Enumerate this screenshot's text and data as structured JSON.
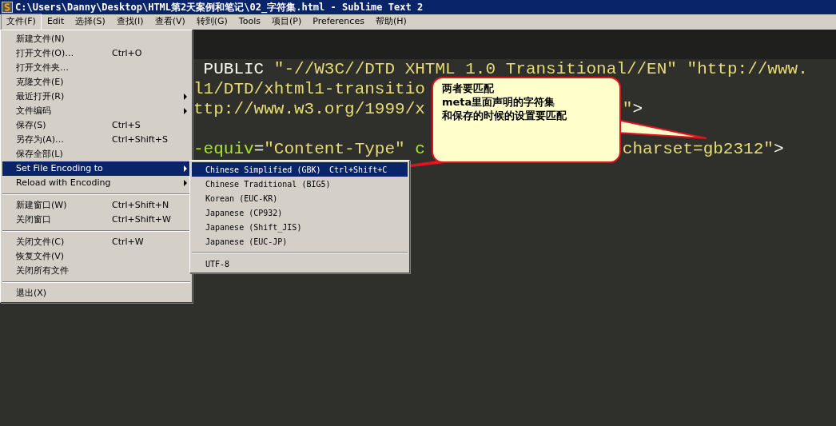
{
  "window": {
    "title": "C:\\Users\\Danny\\Desktop\\HTML第2天案例和笔记\\02_字符集.html - Sublime Text 2"
  },
  "menubar": [
    {
      "label": "文件(F)",
      "selected": true
    },
    {
      "label": "Edit",
      "selected": false
    },
    {
      "label": "选择(S)",
      "selected": false
    },
    {
      "label": "查找(I)",
      "selected": false
    },
    {
      "label": "查看(V)",
      "selected": false
    },
    {
      "label": "转到(G)",
      "selected": false
    },
    {
      "label": "Tools",
      "selected": false
    },
    {
      "label": "项目(P)",
      "selected": false
    },
    {
      "label": "Preferences",
      "selected": false
    },
    {
      "label": "帮助(H)",
      "selected": false
    }
  ],
  "code_lines": [
    {
      "kind": "code",
      "left": [
        {
          "kind": "plain",
          "text": " PUBLIC "
        },
        {
          "kind": "string",
          "text": "\"-//W3C//DTD XHTML 1.0 Transitional//EN\""
        },
        {
          "kind": "string",
          "text": " \"http://www."
        }
      ]
    },
    {
      "kind": "code",
      "left": [
        {
          "kind": "string",
          "text": "l1/DTD/xhtml1-transitio"
        }
      ]
    },
    {
      "kind": "code",
      "left": [
        {
          "kind": "string",
          "text": "ttp://www.w3.org/1999/x"
        }
      ],
      "right": [
        {
          "kind": "string",
          "text": "\""
        },
        {
          "kind": "plain",
          "text": ">"
        }
      ]
    },
    {
      "kind": "blank"
    },
    {
      "kind": "code",
      "left": [
        {
          "kind": "attr",
          "text": "-equiv"
        },
        {
          "kind": "plain",
          "text": "="
        },
        {
          "kind": "string",
          "text": "\"Content-Type\" "
        },
        {
          "kind": "attr",
          "text": "c"
        }
      ],
      "right": [
        {
          "kind": "string",
          "text": "charset=gb2312\""
        },
        {
          "kind": "plain",
          "text": ">"
        }
      ]
    }
  ],
  "file_menu": [
    {
      "kind": "item",
      "label": "新建文件(N)",
      "selected": false
    },
    {
      "kind": "item",
      "label": "打开文件(O)…",
      "shortcut": "Ctrl+O",
      "selected": false
    },
    {
      "kind": "item",
      "label": "打开文件夹…",
      "selected": false
    },
    {
      "kind": "item",
      "label": "克隆文件(E)",
      "selected": false
    },
    {
      "kind": "item",
      "label": "最近打开(R)",
      "submenu": true,
      "selected": false
    },
    {
      "kind": "item",
      "label": "文件编码",
      "submenu": true,
      "selected": false
    },
    {
      "kind": "item",
      "label": "保存(S)",
      "shortcut": "Ctrl+S",
      "selected": false
    },
    {
      "kind": "item",
      "label": "另存为(A)…",
      "shortcut": "Ctrl+Shift+S",
      "selected": false
    },
    {
      "kind": "item",
      "label": "保存全部(L)",
      "selected": false
    },
    {
      "kind": "item",
      "label": "Set File Encoding to",
      "submenu": true,
      "selected": true
    },
    {
      "kind": "item",
      "label": "Reload with Encoding",
      "submenu": true,
      "selected": false
    },
    {
      "kind": "separator"
    },
    {
      "kind": "item",
      "label": "新建窗口(W)",
      "shortcut": "Ctrl+Shift+N",
      "selected": false
    },
    {
      "kind": "item",
      "label": "关闭窗口",
      "shortcut": "Ctrl+Shift+W",
      "selected": false
    },
    {
      "kind": "separator"
    },
    {
      "kind": "item",
      "label": "关闭文件(C)",
      "shortcut": "Ctrl+W",
      "selected": false
    },
    {
      "kind": "item",
      "label": "恢复文件(V)",
      "selected": false
    },
    {
      "kind": "item",
      "label": "关闭所有文件",
      "selected": false
    },
    {
      "kind": "separator"
    },
    {
      "kind": "item",
      "label": "退出(X)",
      "selected": false
    }
  ],
  "encoding_menu": [
    {
      "kind": "item",
      "label": "Chinese Simplified (GBK)",
      "shortcut": "Ctrl+Shift+C",
      "selected": true
    },
    {
      "kind": "item",
      "label": "Chinese Traditional (BIG5)",
      "selected": false
    },
    {
      "kind": "item",
      "label": "Korean (EUC-KR)",
      "selected": false
    },
    {
      "kind": "item",
      "label": "Japanese (CP932)",
      "selected": false
    },
    {
      "kind": "item",
      "label": "Japanese (Shift_JIS)",
      "selected": false
    },
    {
      "kind": "item",
      "label": "Japanese (EUC-JP)",
      "selected": false
    },
    {
      "kind": "separator"
    },
    {
      "kind": "item",
      "label": "UTF-8",
      "selected": false
    }
  ],
  "callout": {
    "lines": [
      "两者要匹配",
      "meta里面声明的字符集",
      "和保存的时候的设置要匹配"
    ]
  }
}
